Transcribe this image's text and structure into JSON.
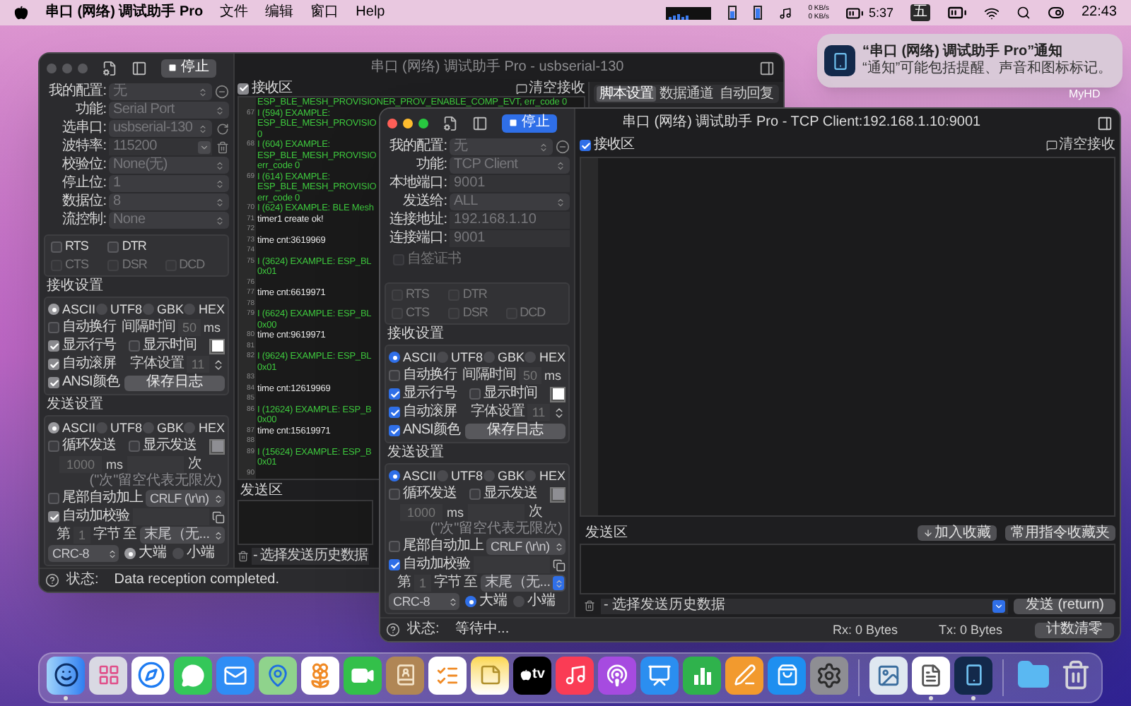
{
  "menu_bar": {
    "app_name": "串口 (网络) 调试助手 Pro",
    "menus": [
      "文件",
      "编辑",
      "窗口",
      "Help"
    ],
    "network_speeds": [
      "0 KB/s",
      "0 KB/s"
    ],
    "battery_time": "5:37",
    "input_method": "五",
    "clock": "22:43"
  },
  "notification": {
    "title": "“串口 (网络) 调试助手 Pro”通知",
    "body": "“通知”可能包括提醒、声音和图标标记。"
  },
  "desktop_label": "MyHD",
  "back_window": {
    "focused": false,
    "stop_button": "停止",
    "title": "串口 (网络) 调试助手 Pro - usbserial-130",
    "inspector_tabs": [
      {
        "label": "脚本设置",
        "selected": true
      },
      {
        "label": "数据通道",
        "selected": false
      },
      {
        "label": "自动回复",
        "selected": false
      }
    ],
    "sidebar": {
      "fields": [
        {
          "label": "我的配置:",
          "value": "无",
          "kind": "select",
          "disabled": true,
          "accessory": {
            "kind": "minus"
          }
        },
        {
          "label": "功能:",
          "value": "Serial Port",
          "kind": "select",
          "disabled": true
        },
        {
          "label": "选串口:",
          "value": "usbserial-130",
          "kind": "select",
          "disabled": true,
          "accessory": {
            "kind": "refresh"
          }
        },
        {
          "label": "波特率:",
          "value": "115200",
          "kind": "combo",
          "disabled": true,
          "accessory": {
            "kind": "trash"
          }
        },
        {
          "label": "校验位:",
          "value": "None(无)",
          "kind": "select",
          "disabled": true
        },
        {
          "label": "停止位:",
          "value": "1",
          "kind": "select",
          "disabled": true
        },
        {
          "label": "数据位:",
          "value": "8",
          "kind": "select",
          "disabled": true
        },
        {
          "label": "流控制:",
          "value": "None",
          "kind": "select",
          "disabled": true
        }
      ],
      "signals": [
        [
          {
            "label": "RTS",
            "checked": false,
            "disabled": false
          },
          {
            "label": "DTR",
            "checked": false,
            "disabled": false
          }
        ],
        [
          {
            "label": "CTS",
            "checked": false,
            "disabled": true
          },
          {
            "label": "DSR",
            "checked": false,
            "disabled": true
          },
          {
            "label": "DCD",
            "checked": false,
            "disabled": true
          }
        ]
      ],
      "receive": {
        "title": "接收设置",
        "encodings": [
          {
            "label": "ASCII",
            "selected": true
          },
          {
            "label": "UTF8",
            "selected": false
          },
          {
            "label": "GBK",
            "selected": false
          },
          {
            "label": "HEX",
            "selected": false
          }
        ],
        "auto_wrap": {
          "label": "自动换行",
          "checked": false
        },
        "interval_label": "间隔时间",
        "interval": "50",
        "interval_unit": "ms",
        "show_line_no": {
          "label": "显示行号",
          "checked": true
        },
        "show_time": {
          "label": "显示时间",
          "checked": false
        },
        "color": "#ffffff",
        "auto_scroll": {
          "label": "自动滚屏",
          "checked": true
        },
        "font_label": "字体设置",
        "font_size": "11",
        "ansi": {
          "label": "ANSI颜色",
          "checked": true
        },
        "save_button": "保存日志"
      },
      "send": {
        "title": "发送设置",
        "encodings": [
          {
            "label": "ASCII",
            "selected": true
          },
          {
            "label": "UTF8",
            "selected": false
          },
          {
            "label": "GBK",
            "selected": false
          },
          {
            "label": "HEX",
            "selected": false
          }
        ],
        "loop": {
          "label": "循环发送",
          "checked": false
        },
        "show_send": {
          "label": "显示发送",
          "checked": false
        },
        "color": "#8e8e93",
        "period": "1000",
        "period_unit": "ms",
        "count_unit": "次",
        "count_note": "(\"次\"留空代表无限次)",
        "append": {
          "label": "尾部自动加上",
          "checked": false
        },
        "append_value": "CRLF (\\r\\n)",
        "checksum": {
          "label": "自动加校验",
          "checked": true
        },
        "from_label": "第",
        "from": "1",
        "byte_label": "字节",
        "to_label": "至",
        "to_value": "末尾（无...",
        "algorithm": "CRC-8",
        "endian": [
          {
            "label": "大端",
            "selected": true
          },
          {
            "label": "小端",
            "selected": false
          }
        ]
      }
    },
    "receive_area": {
      "label": "接收区",
      "checked": true,
      "clear_button": "清空接收",
      "lines": [
        {
          "color": "#3ec83e",
          "text": [
            "ESP_BLE_MESH_PROVISIONER_PROV_ENABLE_COMP_EVT, err_code 0"
          ]
        },
        {
          "no": "67",
          "color": "#3ec83e",
          "text": [
            "I (594) EXAMPLE:",
            "ESP_BLE_MESH_PROVISIO",
            "0"
          ]
        },
        {
          "no": "68",
          "color": "#3ec83e",
          "text": [
            "I (604) EXAMPLE:",
            "ESP_BLE_MESH_PROVISIO",
            "err_code 0"
          ]
        },
        {
          "no": "69",
          "color": "#3ec83e",
          "text": [
            "I (614) EXAMPLE:",
            "ESP_BLE_MESH_PROVISIO",
            "err_code 0"
          ]
        },
        {
          "no": "70",
          "color": "#3ec83e",
          "text": [
            "I (624) EXAMPLE: BLE Mesh"
          ]
        },
        {
          "no": "71",
          "color": "#e8e8e8",
          "text": [
            "timer1 create ok!"
          ]
        },
        {
          "no": "72"
        },
        {
          "no": "73",
          "color": "#e8e8e8",
          "text": [
            "time cnt:3619969"
          ]
        },
        {
          "no": "74"
        },
        {
          "no": "75",
          "color": "#3ec83e",
          "text": [
            "I (3624) EXAMPLE: ESP_BL",
            "0x01"
          ]
        },
        {
          "no": "76"
        },
        {
          "no": "77",
          "color": "#e8e8e8",
          "text": [
            "time cnt:6619971"
          ]
        },
        {
          "no": "78"
        },
        {
          "no": "79",
          "color": "#3ec83e",
          "text": [
            "I (6624) EXAMPLE: ESP_BL",
            "0x00"
          ]
        },
        {
          "no": "80",
          "color": "#e8e8e8",
          "text": [
            "time cnt:9619971"
          ]
        },
        {
          "no": "81"
        },
        {
          "no": "82",
          "color": "#3ec83e",
          "text": [
            "I (9624) EXAMPLE: ESP_BL",
            "0x01"
          ]
        },
        {
          "no": "83"
        },
        {
          "no": "84",
          "color": "#e8e8e8",
          "text": [
            "time cnt:12619969"
          ]
        },
        {
          "no": "85"
        },
        {
          "no": "86",
          "color": "#3ec83e",
          "text": [
            "I (12624) EXAMPLE: ESP_B",
            "0x00"
          ]
        },
        {
          "no": "87",
          "color": "#e8e8e8",
          "text": [
            "time cnt:15619971"
          ]
        },
        {
          "no": "88"
        },
        {
          "no": "89",
          "color": "#3ec83e",
          "text": [
            "I (15624) EXAMPLE: ESP_B",
            "0x01"
          ]
        },
        {
          "no": "90"
        }
      ]
    },
    "send_area_label": "发送区",
    "history": "- 选择发送历史数据",
    "status": {
      "label": "状态:",
      "text": "Data reception completed."
    }
  },
  "front_window": {
    "focused": true,
    "stop_button": "停止",
    "title": "串口 (网络) 调试助手 Pro - TCP Client:192.168.1.10:9001",
    "sidebar": {
      "fields": [
        {
          "label": "我的配置:",
          "value": "无",
          "kind": "select",
          "disabled": true,
          "accessory": {
            "kind": "minus"
          }
        },
        {
          "label": "功能:",
          "value": "TCP Client",
          "kind": "select",
          "disabled": true
        },
        {
          "label": "本地端口:",
          "value": "9001",
          "kind": "text",
          "disabled": true
        },
        {
          "label": "发送给:",
          "value": "ALL",
          "kind": "select",
          "disabled": true
        },
        {
          "label": "连接地址:",
          "value": "192.168.1.10",
          "kind": "text",
          "disabled": true
        },
        {
          "label": "连接端口:",
          "value": "9001",
          "kind": "text",
          "disabled": true
        }
      ],
      "cert": {
        "label": "自签证书",
        "checked": false,
        "disabled": true
      },
      "signals": [
        [
          {
            "label": "RTS",
            "checked": false,
            "disabled": true
          },
          {
            "label": "DTR",
            "checked": false,
            "disabled": true
          }
        ],
        [
          {
            "label": "CTS",
            "checked": false,
            "disabled": true
          },
          {
            "label": "DSR",
            "checked": false,
            "disabled": true
          },
          {
            "label": "DCD",
            "checked": false,
            "disabled": true
          }
        ]
      ],
      "receive": {
        "title": "接收设置",
        "encodings": [
          {
            "label": "ASCII",
            "selected": true
          },
          {
            "label": "UTF8",
            "selected": false
          },
          {
            "label": "GBK",
            "selected": false
          },
          {
            "label": "HEX",
            "selected": false
          }
        ],
        "auto_wrap": {
          "label": "自动换行",
          "checked": false
        },
        "interval_label": "间隔时间",
        "interval": "50",
        "interval_unit": "ms",
        "show_line_no": {
          "label": "显示行号",
          "checked": true
        },
        "show_time": {
          "label": "显示时间",
          "checked": false
        },
        "color": "#ffffff",
        "auto_scroll": {
          "label": "自动滚屏",
          "checked": true
        },
        "font_label": "字体设置",
        "font_size": "11",
        "ansi": {
          "label": "ANSI颜色",
          "checked": true
        },
        "save_button": "保存日志"
      },
      "send": {
        "title": "发送设置",
        "encodings": [
          {
            "label": "ASCII",
            "selected": true
          },
          {
            "label": "UTF8",
            "selected": false
          },
          {
            "label": "GBK",
            "selected": false
          },
          {
            "label": "HEX",
            "selected": false
          }
        ],
        "loop": {
          "label": "循环发送",
          "checked": false
        },
        "show_send": {
          "label": "显示发送",
          "checked": false
        },
        "color": "#8e8e93",
        "period": "1000",
        "period_unit": "ms",
        "count_unit": "次",
        "count_note": "(\"次\"留空代表无限次)",
        "append": {
          "label": "尾部自动加上",
          "checked": false
        },
        "append_value": "CRLF (\\r\\n)",
        "checksum": {
          "label": "自动加校验",
          "checked": true
        },
        "from_label": "第",
        "from": "1",
        "byte_label": "字节",
        "to_label": "至",
        "to_value": "末尾（无...",
        "algorithm": "CRC-8",
        "endian": [
          {
            "label": "大端",
            "selected": true
          },
          {
            "label": "小端",
            "selected": false
          }
        ]
      }
    },
    "receive_area": {
      "label": "接收区",
      "checked": true,
      "clear_button": "清空接收"
    },
    "send_area_label": "发送区",
    "favorite_button": "加入收藏",
    "favorites_button": "常用指令收藏夹",
    "history": "- 选择发送历史数据",
    "send_button": "发送 (return)",
    "status": {
      "label": "状态:",
      "text": "等待中..."
    },
    "rx": "Rx: 0 Bytes",
    "tx": "Tx: 0 Bytes",
    "reset_button": "计数清零"
  },
  "dock": {
    "groups": [
      [
        {
          "kind": "finder",
          "running": true
        },
        {
          "kind": "launchpad",
          "running": false
        },
        {
          "kind": "safari",
          "running": false
        },
        {
          "kind": "messages",
          "running": false
        },
        {
          "kind": "mail",
          "running": false
        },
        {
          "kind": "maps",
          "running": false
        },
        {
          "kind": "photos",
          "running": false
        },
        {
          "kind": "facetime",
          "running": false
        },
        {
          "kind": "contacts",
          "running": false
        },
        {
          "kind": "reminders",
          "running": false
        },
        {
          "kind": "notes",
          "running": false
        },
        {
          "kind": "tv",
          "label": "tv",
          "running": false
        },
        {
          "kind": "music",
          "running": false
        },
        {
          "kind": "podcasts",
          "running": false
        },
        {
          "kind": "keynote",
          "running": false
        },
        {
          "kind": "numbers",
          "running": false
        },
        {
          "kind": "pages",
          "running": false
        },
        {
          "kind": "appstore",
          "running": false
        },
        {
          "kind": "settings",
          "running": false
        }
      ],
      [
        {
          "kind": "preview",
          "running": false
        },
        {
          "kind": "textedit",
          "running": true
        },
        {
          "kind": "serial",
          "running": true
        }
      ],
      [
        {
          "kind": "folder",
          "running": false
        },
        {
          "kind": "trash",
          "running": false
        }
      ]
    ]
  }
}
